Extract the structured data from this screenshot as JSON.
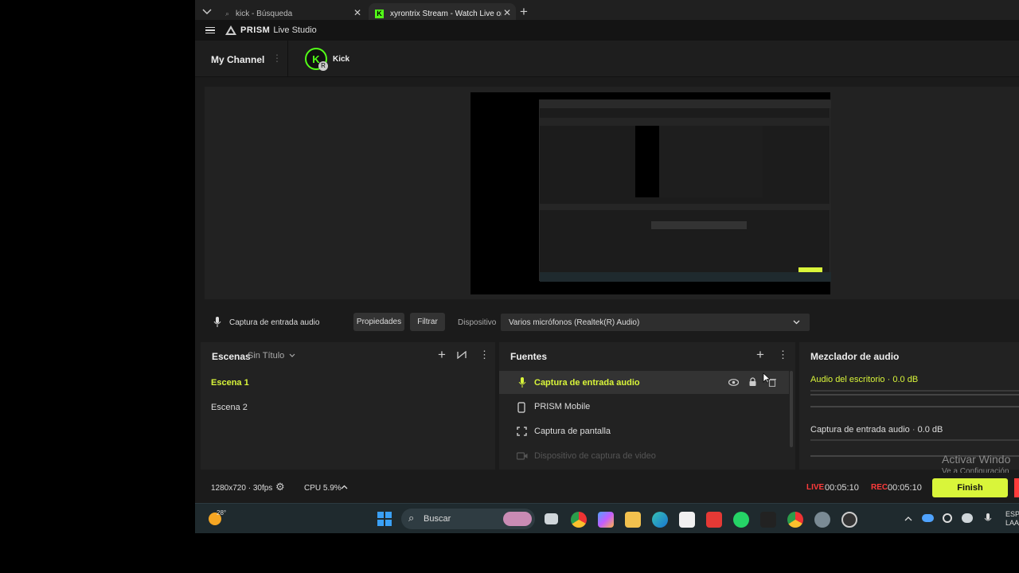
{
  "browser": {
    "tabs": [
      {
        "label": "kick - Búsqueda",
        "active": false
      },
      {
        "label": "xyrontrix Stream - Watch Live on K",
        "active": true
      }
    ],
    "new_tab": "+"
  },
  "app": {
    "name_bold": "PRISM",
    "name_light": "Live Studio"
  },
  "channel": {
    "my_channel": "My Channel",
    "platform": "Kick"
  },
  "source_bar": {
    "source_name": "Captura de entrada audio",
    "properties_label": "Propiedades",
    "filter_label": "Filtrar",
    "device_label": "Dispositivo",
    "device_value": "Varios micrófonos (Realtek(R) Audio)"
  },
  "scenes": {
    "title": "Escenas",
    "collection": "Sin Título",
    "items": [
      {
        "label": "Escena 1",
        "active": true
      },
      {
        "label": "Escena 2",
        "active": false
      }
    ]
  },
  "sources": {
    "title": "Fuentes",
    "items": [
      {
        "label": "Captura de entrada audio",
        "icon": "mic-icon",
        "selected": true
      },
      {
        "label": "PRISM Mobile",
        "icon": "phone-icon",
        "selected": false
      },
      {
        "label": "Captura de pantalla",
        "icon": "screen-capture-icon",
        "selected": false
      },
      {
        "label": "Dispositivo de captura de video",
        "icon": "camera-icon",
        "selected": false,
        "disabled": true
      }
    ]
  },
  "mixer": {
    "title": "Mezclador de audio",
    "channels": [
      {
        "label": "Audio del escritorio",
        "level": "0.0 dB",
        "highlight": true
      },
      {
        "label": "Captura de entrada audio",
        "level": "0.0 dB",
        "highlight": false
      }
    ]
  },
  "status": {
    "resolution": "1280x720",
    "fps": "30fps",
    "cpu": "CPU 5.9%",
    "live_label": "LIVE",
    "live_time": "00:05:10",
    "rec_label": "REC",
    "rec_time": "00:05:10",
    "finish_label": "Finish"
  },
  "watermark": {
    "line1": "Activar Windo",
    "line2": "Ve a Configuración"
  },
  "taskbar": {
    "weather": "28°",
    "search_label": "Buscar",
    "lang1": "ESP",
    "lang2": "LAA"
  },
  "colors": {
    "accent": "#d9f53a",
    "live_red": "#ff3b3b",
    "kick_green": "#53fc18",
    "panel_bg": "#222222"
  }
}
